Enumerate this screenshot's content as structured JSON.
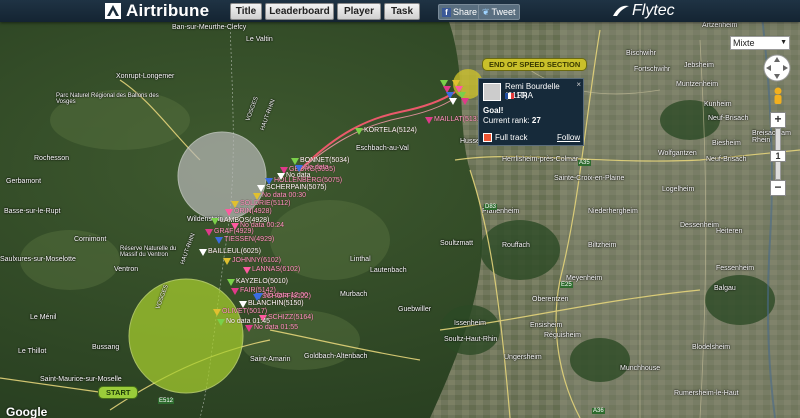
{
  "topbar": {
    "logo_text": "Airtribune",
    "nav": [
      "Title",
      "Leaderboard",
      "Player",
      "Task"
    ],
    "share_label": "Share",
    "tweet_label": "Tweet",
    "sponsor": "Flytec"
  },
  "map": {
    "maptype_selected": "Mixte",
    "zoom_in": "+",
    "zoom_out": "−",
    "zoom_level_label": "1",
    "google_label": "Google",
    "speed_section_label": "END OF SPEED SECTION",
    "start_label": "START",
    "towns": [
      {
        "name": "Ban-sur-Meurthe-Clefcy"
      },
      {
        "name": "Le Valtin"
      },
      {
        "name": "Xonrupt-Longemer"
      },
      {
        "name": "Parc Naturel Régional des Ballons des Vosges"
      },
      {
        "name": "Rochesson"
      },
      {
        "name": "Gerbamont"
      },
      {
        "name": "Basse-sur-le-Rupt"
      },
      {
        "name": "Cornimont"
      },
      {
        "name": "Saulxures-sur-Moselotte"
      },
      {
        "name": "Ventron"
      },
      {
        "name": "Réserve Naturelle du Massif du Ventron"
      },
      {
        "name": "Wildenstein"
      },
      {
        "name": "Le Ménil"
      },
      {
        "name": "Le Thillot"
      },
      {
        "name": "Bussang"
      },
      {
        "name": "Saint-Maurice-sur-Moselle"
      },
      {
        "name": "Saint-Amarin"
      },
      {
        "name": "Goldbach-Altenbach"
      },
      {
        "name": "Linthal"
      },
      {
        "name": "Lautenbach"
      },
      {
        "name": "Murbach"
      },
      {
        "name": "Guebwiller"
      },
      {
        "name": "Issenheim"
      },
      {
        "name": "Soultz-Haut-Rhin"
      },
      {
        "name": "Soultzmatt"
      },
      {
        "name": "Rouffach"
      },
      {
        "name": "Pfaffenheim"
      },
      {
        "name": "Herrlisheim-près-Colmar"
      },
      {
        "name": "Sainte-Croix-en-Plaine"
      },
      {
        "name": "Niederhergheim"
      },
      {
        "name": "Biltzheim"
      },
      {
        "name": "Oberentzen"
      },
      {
        "name": "Ensisheim"
      },
      {
        "name": "Ungersheim"
      },
      {
        "name": "Réguisheim"
      },
      {
        "name": "Munchhouse"
      },
      {
        "name": "Meyenheim"
      },
      {
        "name": "Rumersheim-le-Haut"
      },
      {
        "name": "Blodelsheim"
      },
      {
        "name": "Fessenheim"
      },
      {
        "name": "Balgau"
      },
      {
        "name": "Dessenheim"
      },
      {
        "name": "Heiteren"
      },
      {
        "name": "Logelheim"
      },
      {
        "name": "Wolfgantzen"
      },
      {
        "name": "Neuf-Brisach"
      },
      {
        "name": "Biesheim"
      },
      {
        "name": "Kunheim"
      },
      {
        "name": "Jebsheim"
      },
      {
        "name": "Bischwihr"
      },
      {
        "name": "Fortschwihr"
      },
      {
        "name": "Muntzenheim"
      },
      {
        "name": "Artzenheim"
      },
      {
        "name": "Breisach am Rhein"
      },
      {
        "name": "Neuf-Brisach"
      },
      {
        "name": "Eschbach-au-Val"
      },
      {
        "name": "Husseren"
      }
    ],
    "roads": [
      "A35",
      "A36",
      "E25",
      "E512",
      "D83"
    ],
    "regions": [
      "VOSGES",
      "HAUT-RHIN"
    ],
    "pilot_labels": [
      "BONNET(5034)",
      "GEORG(5035)",
      "HOLLENBERG(5075)",
      "SCHERPAIN(5075)",
      "SOLDRIE(5112)",
      "ORIN(4928)",
      "LAMBOS(4928)",
      "GRAF(4929)",
      "TIESSEN(4929)",
      "BAILLEUL(6025)",
      "JOHNNY(6102)",
      "LANNAS(6102)",
      "KAYZELO(5010)",
      "FAIR(5142)",
      "SCHOFF(8122)",
      "BLANCHIN(5150)",
      "OLIVET(5017)",
      "SCHIZZ(5164)",
      "KORTELA(5124)",
      "MAILLAT(5131)",
      "No data",
      "No data",
      "No data 00:30",
      "No data 00:24",
      "No data 01:45",
      "No data 01:55",
      "No data 12:00"
    ]
  },
  "infobox": {
    "pilot": "Remi Bourdelle (6110)",
    "country": "FRA",
    "status": "Goal!",
    "rank_label": "Current rank:",
    "rank_value": "27",
    "full_track_label": "Full track",
    "follow_label": "Follow",
    "close": "×"
  },
  "colors": {
    "topbar": "#1a2c3b",
    "track": "#ff4f6a",
    "start_circle": "#a8cf2e",
    "grey_circle": "#b9b9b9",
    "ess_circle": "#d1c42a"
  }
}
